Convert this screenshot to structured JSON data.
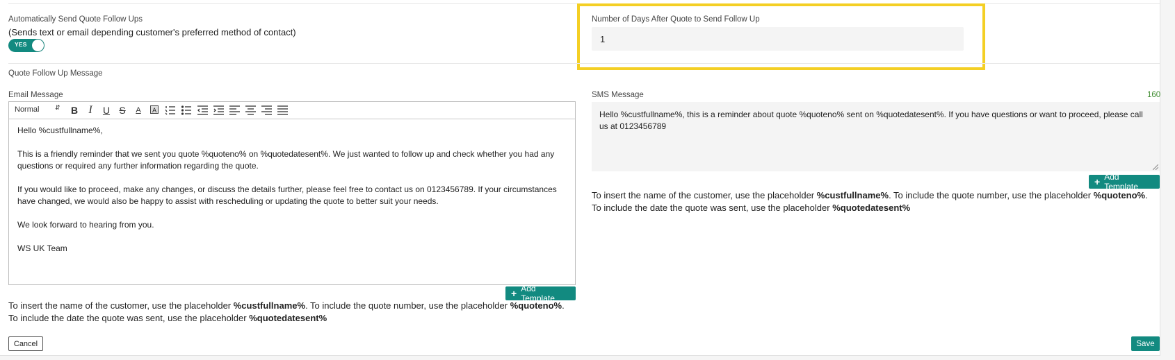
{
  "auto_follow_up": {
    "title": "Automatically Send Quote Follow Ups",
    "subtitle": "(Sends text or email depending customer's preferred method of contact)",
    "toggle_label": "YES",
    "toggle_on": true
  },
  "days_after": {
    "label": "Number of Days After Quote to Send Follow Up",
    "value": "1"
  },
  "section_title": "Quote Follow Up Message",
  "email": {
    "label": "Email Message",
    "format_select": "Normal",
    "body": [
      "Hello %custfullname%,",
      "This is a friendly reminder that we sent you quote %quoteno% on %quotedatesent%. We just wanted to follow up and check whether you had any questions or required any further information regarding the quote.",
      "If you would like to proceed, make any changes, or discuss the details further, please feel free to contact us on 0123456789. If your circumstances have changed, we would also be happy to assist with rescheduling or updating the quote to better suit your needs.",
      "We look forward to hearing from you.",
      "WS UK Team"
    ],
    "add_template": "Add Template"
  },
  "sms": {
    "label": "SMS Message",
    "char_count": "160",
    "value": "Hello %custfullname%, this is a reminder about quote %quoteno% sent on %quotedatesent%. If you have questions or want to proceed, please call us at 0123456789",
    "add_template": "Add Template"
  },
  "help": {
    "t1": "To insert the name of the customer, use the placeholder ",
    "p1": "%custfullname%",
    "t2": ".  To include the quote number, use the placeholder ",
    "p2": "%quoteno%",
    "t3": ".  To include the date the quote was sent, use the placeholder ",
    "p3": "%quotedatesent%"
  },
  "actions": {
    "cancel": "Cancel",
    "save": "Save"
  },
  "colors": {
    "accent": "#128a80",
    "highlight": "#f4cf24",
    "count": "#3d8a2e"
  }
}
